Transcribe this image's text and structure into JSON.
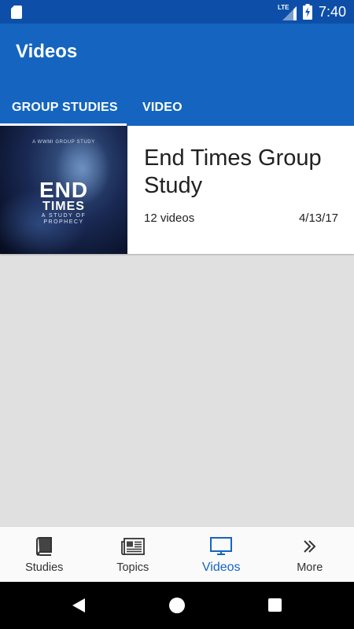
{
  "status_bar": {
    "time": "7:40",
    "network": "LTE"
  },
  "app_bar": {
    "title": "Videos"
  },
  "tabs": [
    {
      "label": "GROUP STUDIES",
      "active": true
    },
    {
      "label": "VIDEO",
      "active": false
    }
  ],
  "study_card": {
    "thumbnail": {
      "tagline": "A WWMI GROUP STUDY",
      "title_line1": "END",
      "title_line2": "TIMES",
      "subtitle_line1": "A STUDY OF",
      "subtitle_line2": "PROPHECY"
    },
    "title": "End Times Group Study",
    "video_count": "12 videos",
    "date": "4/13/17"
  },
  "bottom_nav": [
    {
      "label": "Studies",
      "icon": "book-icon",
      "active": false
    },
    {
      "label": "Topics",
      "icon": "newspaper-icon",
      "active": false
    },
    {
      "label": "Videos",
      "icon": "monitor-icon",
      "active": true
    },
    {
      "label": "More",
      "icon": "double-chevron-right-icon",
      "active": false
    }
  ],
  "colors": {
    "primary": "#1565c0",
    "status_bar": "#0d4fa8",
    "background": "#e0e0e0"
  }
}
